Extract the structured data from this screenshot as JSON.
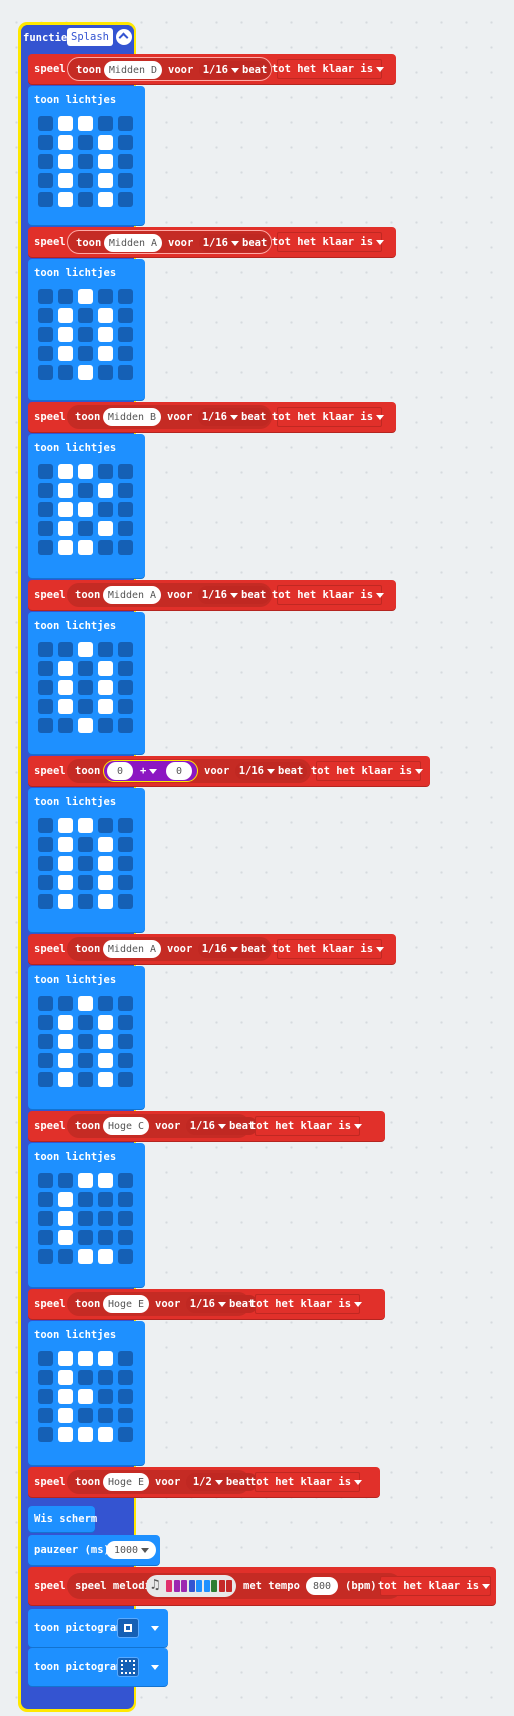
{
  "function": {
    "keyword": "functie",
    "name": "Splash"
  },
  "labels": {
    "play": "speel",
    "tone": "toon",
    "for": "voor",
    "beat": "beat",
    "until_done": "tot het klaar is",
    "show_leds": "toon lichtjes",
    "clear_screen": "Wis scherm",
    "pause": "pauzeer (ms)",
    "play_melody": "speel melodie",
    "tempo": "met tempo",
    "bpm": "(bpm)",
    "show_icon": "toon pictogram",
    "plus": "+"
  },
  "tones": [
    {
      "note": "Midden D",
      "duration": "1/16"
    },
    {
      "note": "Midden A",
      "duration": "1/16"
    },
    {
      "note": "Midden B",
      "duration": "1/16"
    },
    {
      "note": "Midden A",
      "duration": "1/16"
    },
    {
      "note": "",
      "duration": "1/16",
      "expr": {
        "a": "0",
        "b": "0"
      }
    },
    {
      "note": "Midden A",
      "duration": "1/16"
    },
    {
      "note": "Hoge C",
      "duration": "1/16"
    },
    {
      "note": "Hoge E",
      "duration": "1/16"
    },
    {
      "note": "Hoge E",
      "duration": "1/2"
    }
  ],
  "led_patterns": [
    [
      "01100",
      "01010",
      "01010",
      "01010",
      "01010"
    ],
    [
      "00100",
      "01010",
      "01010",
      "01010",
      "00100"
    ],
    [
      "01100",
      "01010",
      "01100",
      "01010",
      "01100"
    ],
    [
      "00100",
      "01010",
      "01010",
      "01010",
      "00100"
    ],
    [
      "01100",
      "01010",
      "01010",
      "01010",
      "01010"
    ],
    [
      "00100",
      "01010",
      "01010",
      "01010",
      "01010"
    ],
    [
      "00110",
      "01000",
      "01000",
      "01000",
      "00110"
    ],
    [
      "01110",
      "01000",
      "01100",
      "01000",
      "01110"
    ]
  ],
  "pause_ms": "1000",
  "melody": {
    "tempo": "800",
    "colors": [
      "#e1306c",
      "#9c27b0",
      "#9c27b0",
      "#3454d1",
      "#1e90ff",
      "#1e90ff",
      "#2e7d32",
      "#c62828",
      "#c62828"
    ]
  },
  "icons": [
    "small-square-icon",
    "large-square-icon"
  ]
}
